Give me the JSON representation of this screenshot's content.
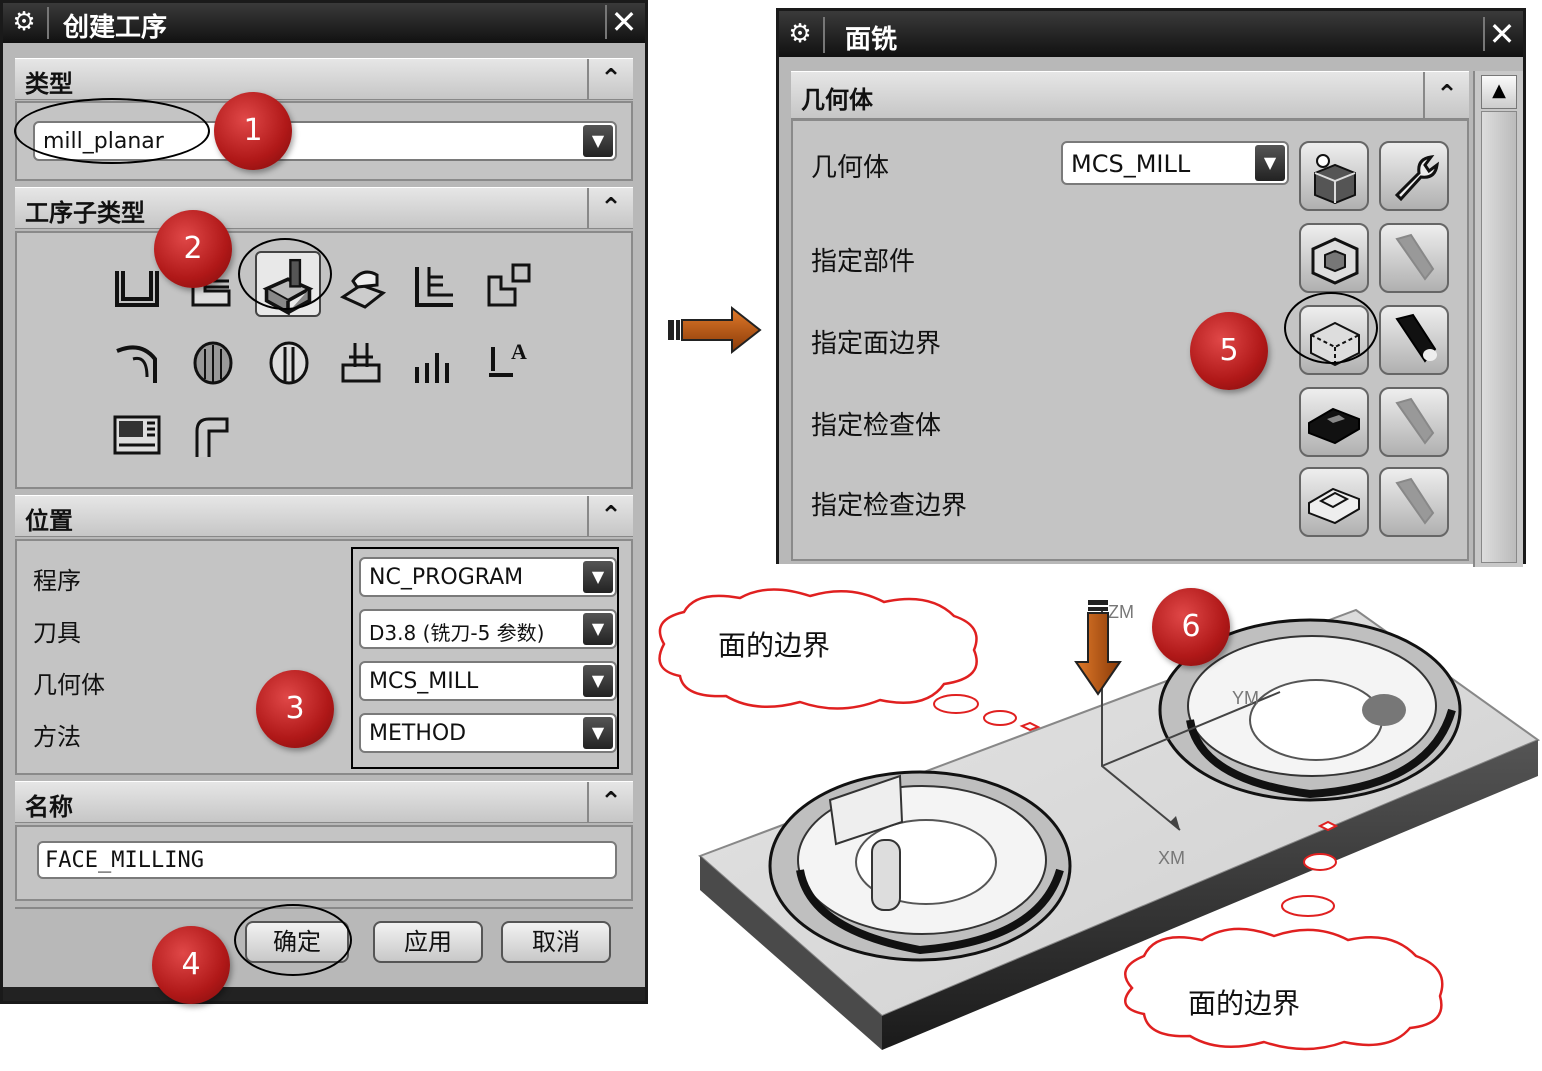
{
  "left_dialog": {
    "title": "创建工序",
    "sections": {
      "type": "类型",
      "subtype": "工序子类型",
      "location": "位置",
      "name": "名称"
    },
    "type_value": "mill_planar",
    "location_rows": [
      {
        "label": "程序",
        "value": "NC_PROGRAM"
      },
      {
        "label": "刀具",
        "value": "D3.8 (铣刀-5 参数)"
      },
      {
        "label": "几何体",
        "value": "MCS_MILL"
      },
      {
        "label": "方法",
        "value": "METHOD"
      }
    ],
    "name_value": "FACE_MILLING",
    "buttons": {
      "ok": "确定",
      "apply": "应用",
      "cancel": "取消"
    }
  },
  "right_dialog": {
    "title": "面铣",
    "section": "几何体",
    "geometry_label": "几何体",
    "geometry_value": "MCS_MILL",
    "rows": [
      "指定部件",
      "指定面边界",
      "指定检查体",
      "指定检查边界"
    ]
  },
  "callouts": [
    "1",
    "2",
    "3",
    "4",
    "5",
    "6"
  ],
  "clouds": [
    "面的边界",
    "面的边界"
  ],
  "axes": {
    "zm": "ZM",
    "ym": "YM",
    "xm": "XM"
  },
  "colors": {
    "badge": "#b01818",
    "arrow": "#c0601a",
    "cloud": "#e02020"
  }
}
